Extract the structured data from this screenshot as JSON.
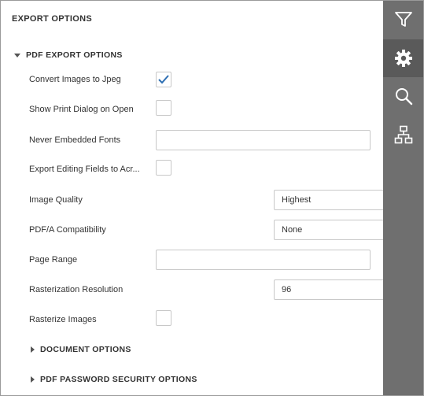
{
  "header": {
    "title": "EXPORT OPTIONS"
  },
  "pdf_section": {
    "title": "PDF EXPORT OPTIONS",
    "expanded": true,
    "rows": [
      {
        "label": "Convert Images to Jpeg",
        "type": "checkbox",
        "checked": true
      },
      {
        "label": "Show Print Dialog on Open",
        "type": "checkbox",
        "checked": false
      },
      {
        "label": "Never Embedded Fonts",
        "type": "text",
        "value": ""
      },
      {
        "label": "Export Editing Fields to Acr...",
        "type": "checkbox",
        "checked": false
      },
      {
        "label": "Image Quality",
        "type": "select",
        "value": "Highest"
      },
      {
        "label": "PDF/A Compatibility",
        "type": "select",
        "value": "None"
      },
      {
        "label": "Page Range",
        "type": "text",
        "value": ""
      },
      {
        "label": "Rasterization Resolution",
        "type": "spinner",
        "value": "96"
      },
      {
        "label": "Rasterize Images",
        "type": "checkbox",
        "checked": false
      }
    ]
  },
  "subsections": [
    {
      "title": "DOCUMENT OPTIONS",
      "expanded": false
    },
    {
      "title": "PDF PASSWORD SECURITY OPTIONS",
      "expanded": false
    }
  ],
  "toolbar": {
    "items": [
      {
        "icon": "filter-icon",
        "active": false
      },
      {
        "icon": "gear-icon",
        "active": true
      },
      {
        "icon": "search-icon",
        "active": false
      },
      {
        "icon": "document-map-icon",
        "active": false
      }
    ]
  },
  "colors": {
    "toolbar_bg": "#6f6f6f",
    "toolbar_active": "#5a5a5a",
    "checkmark": "#2e6fb3"
  }
}
